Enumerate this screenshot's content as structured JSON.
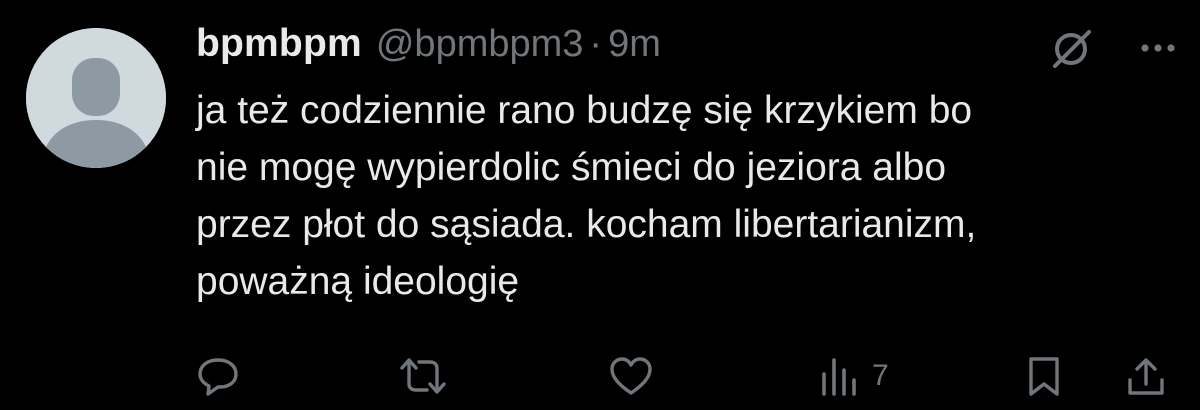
{
  "tweet": {
    "display_name": "bpmbpm",
    "handle": "@bpmbpm3",
    "separator": "·",
    "time": "9m",
    "text": "ja też codziennie rano budzę się krzykiem bo\nnie mogę wypierdolic śmieci do jeziora albo\nprzez płot do sąsiada. kocham libertarianizm,\npoważną ideologię"
  },
  "top_icons": [
    "grok-icon",
    "more-icon"
  ],
  "actions": {
    "items": [
      "reply-icon",
      "retweet-icon",
      "like-icon",
      "views-icon",
      "bookmark-icon",
      "share-icon"
    ],
    "views_count": "7"
  },
  "colors": {
    "background": "#000000",
    "text_primary": "#e7e9ea",
    "text_secondary": "#71767b",
    "avatar_bg": "#cfd9de",
    "avatar_fg": "#8d99a3"
  }
}
